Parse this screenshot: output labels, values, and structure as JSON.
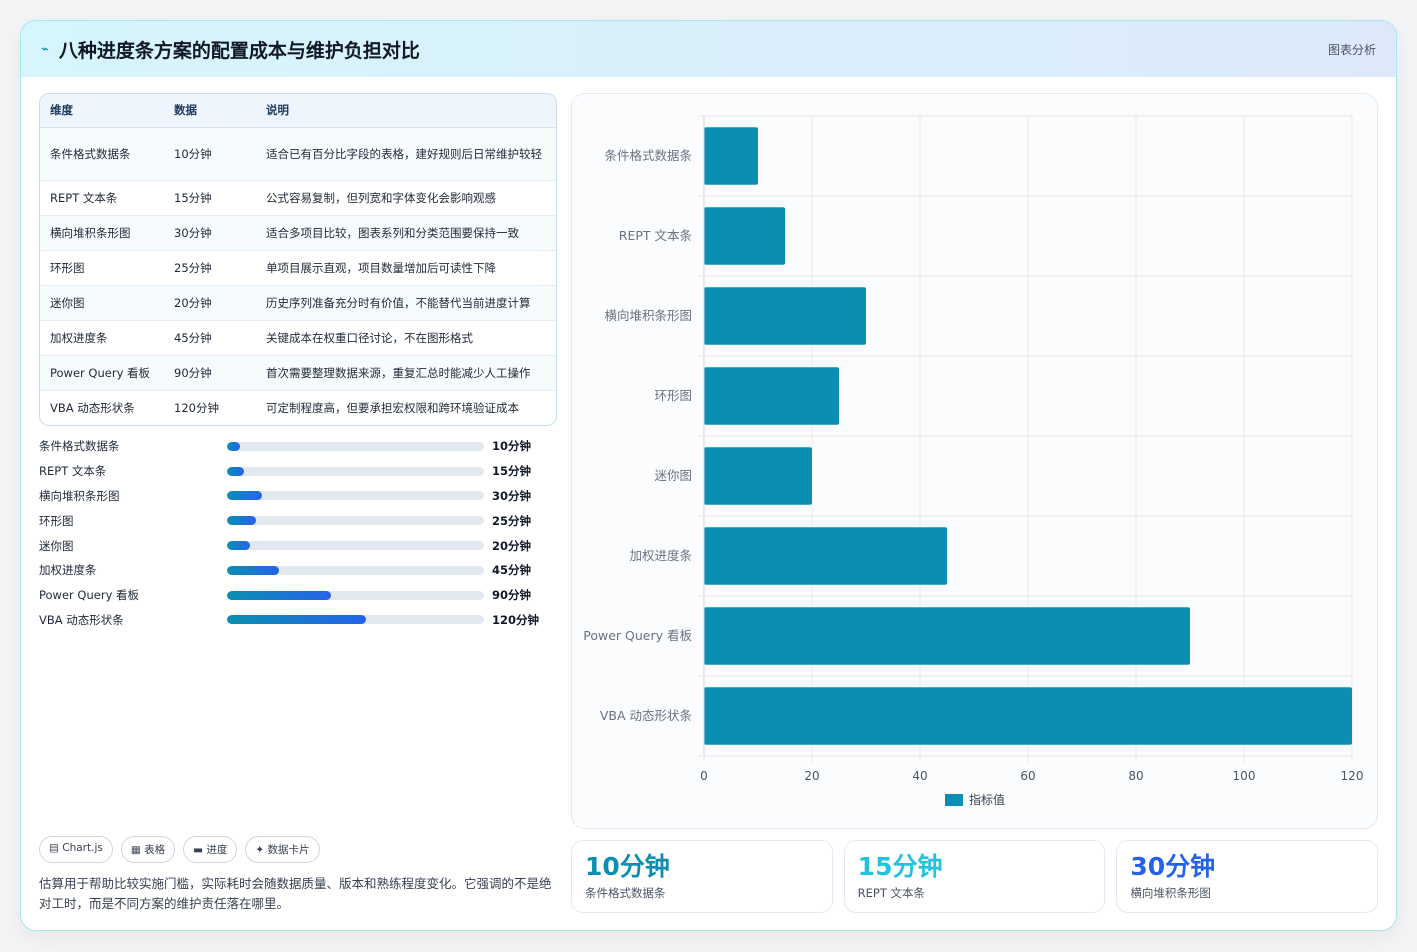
{
  "header": {
    "icon": "bolt-icon",
    "title": "八种进度条方案的配置成本与维护负担对比",
    "tag": "图表分析"
  },
  "table": {
    "headers": [
      "维度",
      "数据",
      "说明"
    ],
    "rows": [
      [
        "条件格式数据条",
        "10分钟",
        "适合已有百分比字段的表格，建好规则后日常维护较轻"
      ],
      [
        "REPT 文本条",
        "15分钟",
        "公式容易复制，但列宽和字体变化会影响观感"
      ],
      [
        "横向堆积条形图",
        "30分钟",
        "适合多项目比较，图表系列和分类范围要保持一致"
      ],
      [
        "环形图",
        "25分钟",
        "单项目展示直观，项目数量增加后可读性下降"
      ],
      [
        "迷你图",
        "20分钟",
        "历史序列准备充分时有价值，不能替代当前进度计算"
      ],
      [
        "加权进度条",
        "45分钟",
        "关键成本在权重口径讨论，不在图形格式"
      ],
      [
        "Power Query 看板",
        "90分钟",
        "首次需要整理数据来源，重复汇总时能减少人工操作"
      ],
      [
        "VBA 动态形状条",
        "120分钟",
        "可定制程度高，但要承担宏权限和跨环境验证成本"
      ]
    ]
  },
  "progress": {
    "max": 120,
    "items": [
      {
        "label": "条件格式数据条",
        "value": 10,
        "text": "10分钟"
      },
      {
        "label": "REPT 文本条",
        "value": 15,
        "text": "15分钟"
      },
      {
        "label": "横向堆积条形图",
        "value": 30,
        "text": "30分钟"
      },
      {
        "label": "环形图",
        "value": 25,
        "text": "25分钟"
      },
      {
        "label": "迷你图",
        "value": 20,
        "text": "20分钟"
      },
      {
        "label": "加权进度条",
        "value": 45,
        "text": "45分钟"
      },
      {
        "label": "Power Query 看板",
        "value": 90,
        "text": "90分钟"
      },
      {
        "label": "VBA 动态形状条",
        "value": 120,
        "text": "120分钟"
      }
    ]
  },
  "chips": [
    "▤ Chart.js",
    "▦ 表格",
    "▬ 进度",
    "✦ 数据卡片"
  ],
  "note": "估算用于帮助比较实施门槛，实际耗时会随数据质量、版本和熟练程度变化。它强调的不是绝对工时，而是不同方案的维护责任落在哪里。",
  "chart_data": {
    "type": "bar",
    "orientation": "horizontal",
    "categories": [
      "条件格式数据条",
      "REPT 文本条",
      "横向堆积条形图",
      "环形图",
      "迷你图",
      "加权进度条",
      "Power Query 看板",
      "VBA 动态形状条"
    ],
    "series": [
      {
        "name": "指标值",
        "values": [
          10,
          15,
          30,
          25,
          20,
          45,
          90,
          120
        ]
      }
    ],
    "xlim": [
      0,
      120
    ],
    "xticks": [
      0,
      20,
      40,
      60,
      80,
      100,
      120
    ],
    "grid": true,
    "legend": "bottom",
    "bar_color": "#0a8fb2"
  },
  "kpis": [
    {
      "value": "10分钟",
      "label": "条件格式数据条",
      "color": "#0b8fb0"
    },
    {
      "value": "15分钟",
      "label": "REPT 文本条",
      "color": "#22c3dd"
    },
    {
      "value": "30分钟",
      "label": "横向堆积条形图",
      "color": "#2563eb"
    }
  ]
}
